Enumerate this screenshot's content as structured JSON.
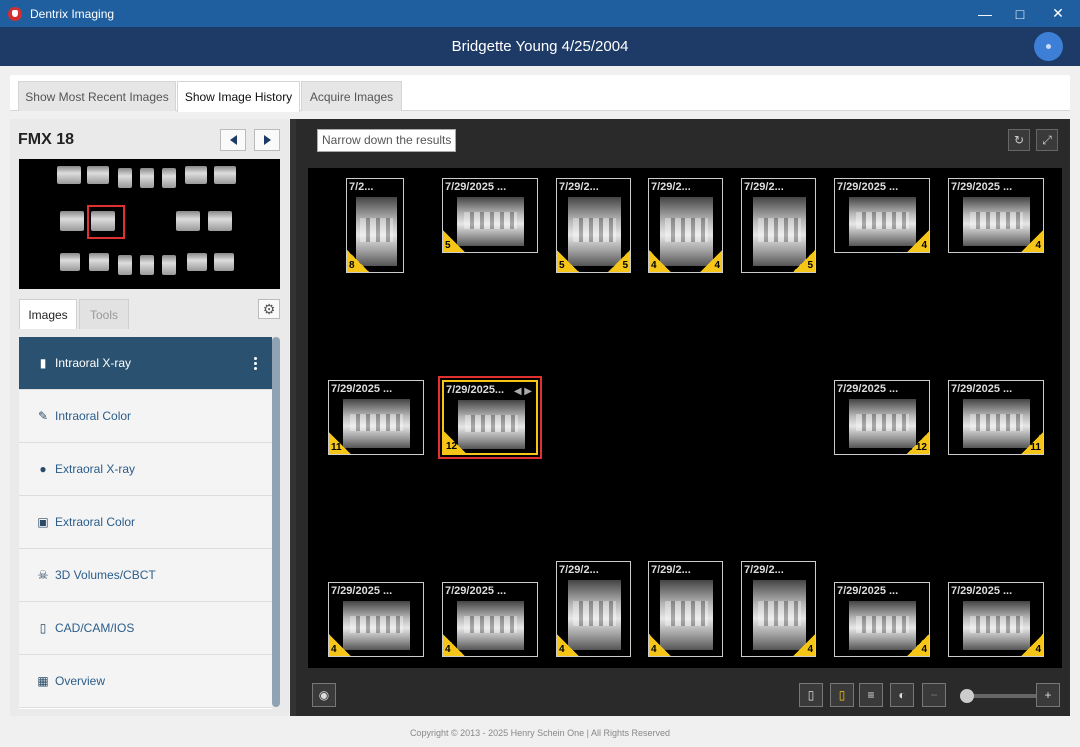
{
  "window": {
    "title": "Dentrix Imaging"
  },
  "header": {
    "patient": "Bridgette Young 4/25/2004"
  },
  "tabs": [
    {
      "label": "Show Most Recent Images"
    },
    {
      "label": "Show Image History"
    },
    {
      "label": "Acquire Images"
    }
  ],
  "active_tab": "Show Image History",
  "left": {
    "series_title": "FMX 18",
    "tabs": [
      {
        "label": "Images"
      },
      {
        "label": "Tools"
      }
    ],
    "categories": [
      {
        "label": "Intraoral X-ray",
        "icon": "tooth-icon"
      },
      {
        "label": "Intraoral Color",
        "icon": "pen-icon"
      },
      {
        "label": "Extraoral X-ray",
        "icon": "head-icon"
      },
      {
        "label": "Extraoral Color",
        "icon": "camera-icon"
      },
      {
        "label": "3D Volumes/CBCT",
        "icon": "skull-icon"
      },
      {
        "label": "CAD/CAM/IOS",
        "icon": "implant-icon"
      },
      {
        "label": "Overview",
        "icon": "grid-icon"
      }
    ]
  },
  "viewer": {
    "filter_placeholder": "Narrow down the results",
    "images": [
      {
        "date": "7/2...",
        "count": "8",
        "pos": "bl"
      },
      {
        "date": "7/29/2025 ...",
        "count": "5",
        "pos": "bl"
      },
      {
        "date": "7/29/2...",
        "count": "5",
        "pos": "bl",
        "count2": "5"
      },
      {
        "date": "7/29/2...",
        "count": "4",
        "pos": "bl",
        "count2": "4"
      },
      {
        "date": "7/29/2...",
        "count": "5",
        "pos": "br"
      },
      {
        "date": "7/29/2025 ...",
        "count": "4",
        "pos": "br"
      },
      {
        "date": "7/29/2025 ...",
        "count": "4",
        "pos": "br"
      },
      {
        "date": "7/29/2025 ...",
        "count": "11",
        "pos": "bl"
      },
      {
        "date": "7/29/2025...",
        "count": "12",
        "pos": "bl"
      },
      {
        "date": "7/29/2025 ...",
        "count": "12",
        "pos": "br"
      },
      {
        "date": "7/29/2025 ...",
        "count": "11",
        "pos": "br"
      },
      {
        "date": "7/29/2025 ...",
        "count": "4",
        "pos": "bl"
      },
      {
        "date": "7/29/2025 ...",
        "count": "4",
        "pos": "bl"
      },
      {
        "date": "7/29/2...",
        "count": "4",
        "pos": "bl"
      },
      {
        "date": "7/29/2...",
        "count": "4",
        "pos": "bl"
      },
      {
        "date": "7/29/2...",
        "count": "4",
        "pos": "br"
      },
      {
        "date": "7/29/2025 ...",
        "count": "4",
        "pos": "br"
      },
      {
        "date": "7/29/2025 ...",
        "count": "4",
        "pos": "br"
      }
    ]
  },
  "footer": {
    "copyright": "Copyright © 2013 - 2025 Henry Schein One | All Rights Reserved"
  },
  "colors": {
    "header": "#1d3b66",
    "titlebar": "#1f5fa0",
    "badge": "#f5c518",
    "selection": "#e03030",
    "active_category": "#2a5270"
  }
}
